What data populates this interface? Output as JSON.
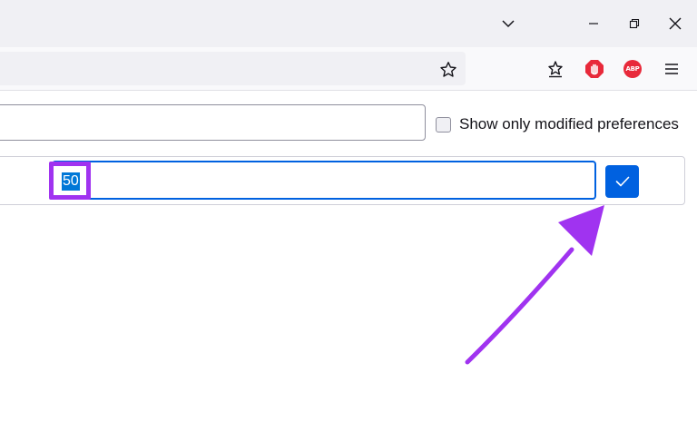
{
  "window": {
    "controls": [
      "chevron-down-icon",
      "minimize-icon",
      "restore-icon",
      "close-icon"
    ]
  },
  "navbar": {
    "icons": [
      "bookmark-star-icon",
      "extensions-star-icon",
      "stop-hand-icon",
      "adblock-plus-icon",
      "hamburger-menu-icon"
    ],
    "abp_label": "ABP"
  },
  "filter": {
    "checkbox_label": "Show only modified preferences",
    "checked": false
  },
  "preference": {
    "value": "50",
    "value_selected": true
  },
  "colors": {
    "accent": "#0061e0",
    "selection": "#0078d7",
    "annotation": "#a033f0",
    "abp_red": "#e8293a"
  }
}
